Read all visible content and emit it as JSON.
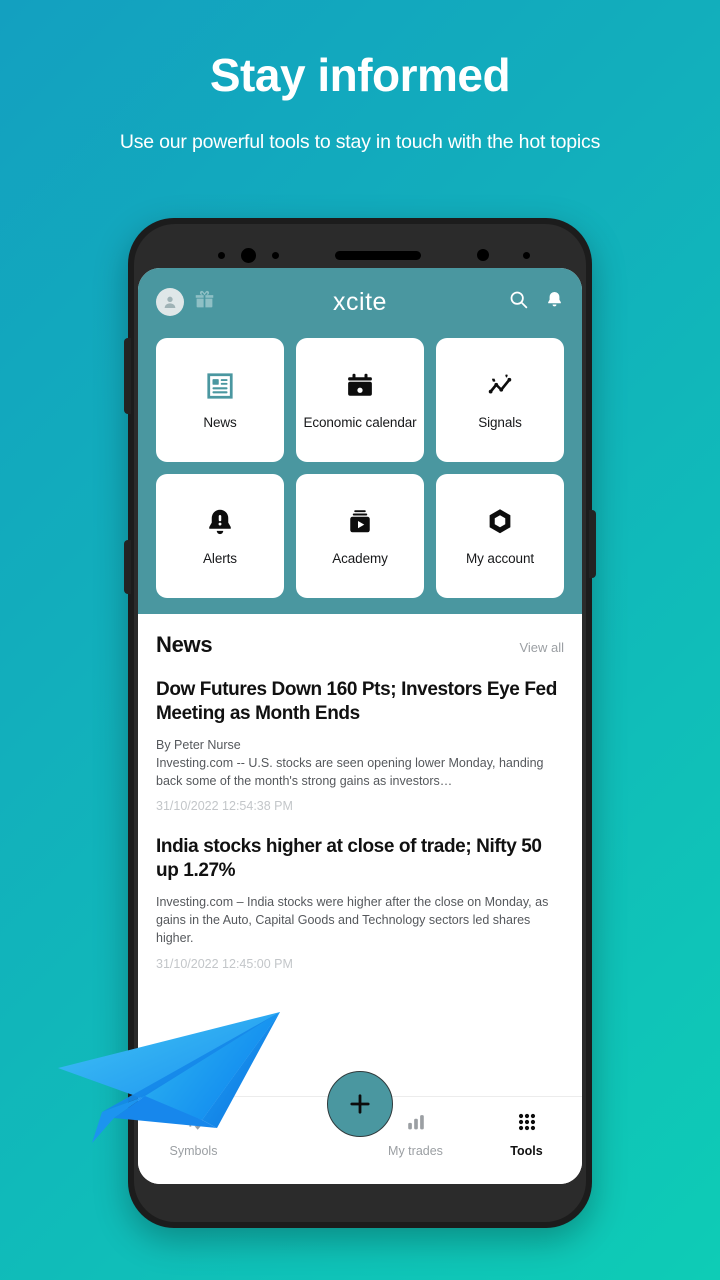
{
  "promo": {
    "title": "Stay informed",
    "subtitle": "Use our powerful tools to stay in touch with the hot topics"
  },
  "colors": {
    "bg_gradient_start": "#13A0C0",
    "bg_gradient_end": "#0ECCB6",
    "app_header_teal": "#4A97A0",
    "accent": "#4A97A0",
    "plane_blue": "#1F8EF5",
    "plane_blue_light": "#31B7F2"
  },
  "app": {
    "brand": "xcite",
    "topbar": {
      "avatar_icon": "user-avatar-icon",
      "gift_icon": "gift-icon",
      "search_icon": "search-icon",
      "bell_icon": "bell-icon"
    },
    "tiles": [
      {
        "label": "News",
        "icon": "newspaper-icon",
        "active": true
      },
      {
        "label": "Economic calendar",
        "icon": "calendar-icon",
        "active": false
      },
      {
        "label": "Signals",
        "icon": "signal-chart-icon",
        "active": false
      },
      {
        "label": "Alerts",
        "icon": "bell-alert-icon",
        "active": false
      },
      {
        "label": "Academy",
        "icon": "video-play-icon",
        "active": false
      },
      {
        "label": "My account",
        "icon": "hexagon-icon",
        "active": false
      }
    ],
    "news": {
      "section_title": "News",
      "view_all_label": "View all",
      "articles": [
        {
          "headline": "Dow Futures Down 160 Pts; Investors Eye Fed Meeting as Month Ends",
          "byline": "By Peter Nurse",
          "summary": "Investing.com -- U.S. stocks are seen opening lower Monday, handing back some of the month's strong gains as investors…",
          "timestamp": "31/10/2022 12:54:38 PM"
        },
        {
          "headline": "India stocks higher at close of trade; Nifty 50 up 1.27%",
          "byline": "",
          "summary": "Investing.com – India stocks were higher after the close on Monday, as gains in the Auto, Capital Goods and Technology sectors led shares higher.",
          "timestamp": "31/10/2022 12:45:00 PM"
        }
      ]
    },
    "bottom_nav": {
      "fab_icon": "plus-icon",
      "items": [
        {
          "label": "Symbols",
          "icon": "transfer-arrows-icon",
          "active": false
        },
        {
          "label": "My trades",
          "icon": "bar-chart-icon",
          "active": false
        },
        {
          "label": "Tools",
          "icon": "grid-dots-icon",
          "active": true
        }
      ]
    }
  }
}
